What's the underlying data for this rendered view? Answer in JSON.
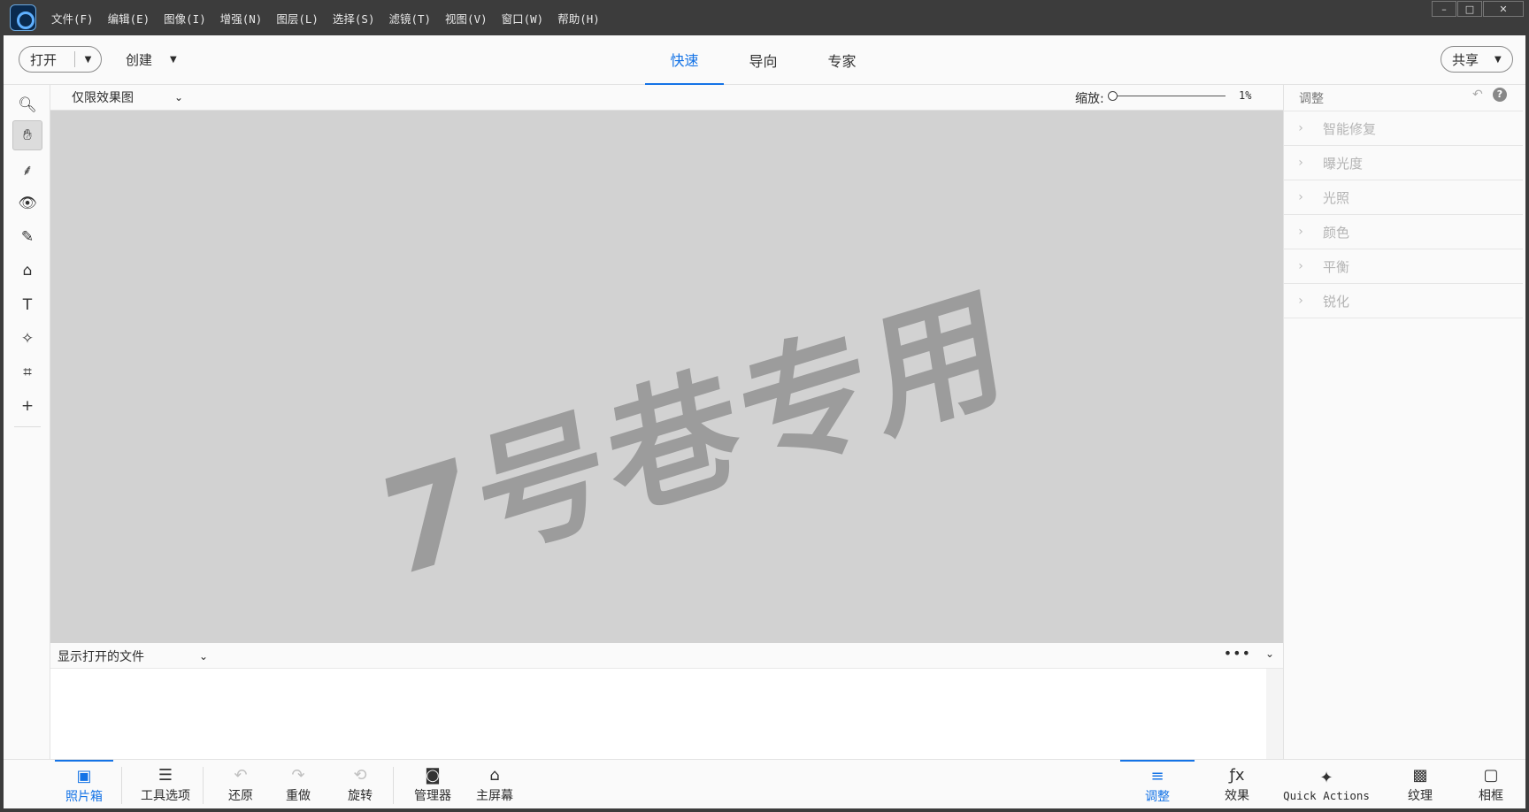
{
  "menu": [
    "文件(F)",
    "编辑(E)",
    "图像(I)",
    "增强(N)",
    "图层(L)",
    "选择(S)",
    "滤镜(T)",
    "视图(V)",
    "窗口(W)",
    "帮助(H)"
  ],
  "window_controls": {
    "minimize": "–",
    "maximize": "□",
    "close": "✕"
  },
  "topbar": {
    "open_label": "打开",
    "create_label": "创建",
    "modes": [
      "快速",
      "导向",
      "专家"
    ],
    "active_mode": "快速",
    "share_label": "共享"
  },
  "tools": [
    {
      "name": "zoom-tool",
      "glyph": "🔍︎"
    },
    {
      "name": "hand-tool",
      "glyph": "✋︎"
    },
    {
      "name": "quick-selection-tool",
      "glyph": "⸙"
    },
    {
      "name": "red-eye-tool",
      "glyph": "👁︎"
    },
    {
      "name": "whiten-teeth-tool",
      "glyph": "✎"
    },
    {
      "name": "spot-healing-tool",
      "glyph": "⌂"
    },
    {
      "name": "type-tool",
      "glyph": "T"
    },
    {
      "name": "smart-brush-tool",
      "glyph": "✧"
    },
    {
      "name": "crop-tool",
      "glyph": "⌗"
    },
    {
      "name": "move-tool",
      "glyph": "+"
    }
  ],
  "view": {
    "select_label": "仅限效果图",
    "zoom_label": "缩放:",
    "zoom_value": "1%",
    "zoom_level_percent": 1
  },
  "canvas": {
    "watermark": "7号巷专用"
  },
  "bin": {
    "select_label": "显示打开的文件",
    "more": "•••"
  },
  "panel": {
    "title": "调整",
    "items": [
      "智能修复",
      "曝光度",
      "光照",
      "颜色",
      "平衡",
      "锐化"
    ]
  },
  "taskbar": {
    "left": [
      {
        "label": "照片箱",
        "icon": "photo-bin-icon",
        "glyph": "▣"
      },
      {
        "label": "工具选项",
        "icon": "tool-options-icon",
        "glyph": "☰"
      },
      {
        "label": "还原",
        "icon": "undo-icon",
        "glyph": "↶"
      },
      {
        "label": "重做",
        "icon": "redo-icon",
        "glyph": "↷"
      },
      {
        "label": "旋转",
        "icon": "rotate-icon",
        "glyph": "⟲"
      },
      {
        "label": "管理器",
        "icon": "organizer-icon",
        "glyph": "◙"
      },
      {
        "label": "主屏幕",
        "icon": "home-icon",
        "glyph": "⌂"
      }
    ],
    "right": [
      {
        "label": "调整",
        "icon": "adjustments-icon",
        "glyph": "≡"
      },
      {
        "label": "效果",
        "icon": "effects-icon",
        "glyph": "ƒx"
      },
      {
        "label": "Quick Actions",
        "icon": "quick-actions-icon",
        "glyph": "✦"
      },
      {
        "label": "纹理",
        "icon": "textures-icon",
        "glyph": "▩"
      },
      {
        "label": "相框",
        "icon": "frames-icon",
        "glyph": "▢"
      }
    ]
  },
  "colors": {
    "accent": "#1473e6",
    "titlebar": "#3c3c3c",
    "canvas": "#d2d2d2"
  }
}
